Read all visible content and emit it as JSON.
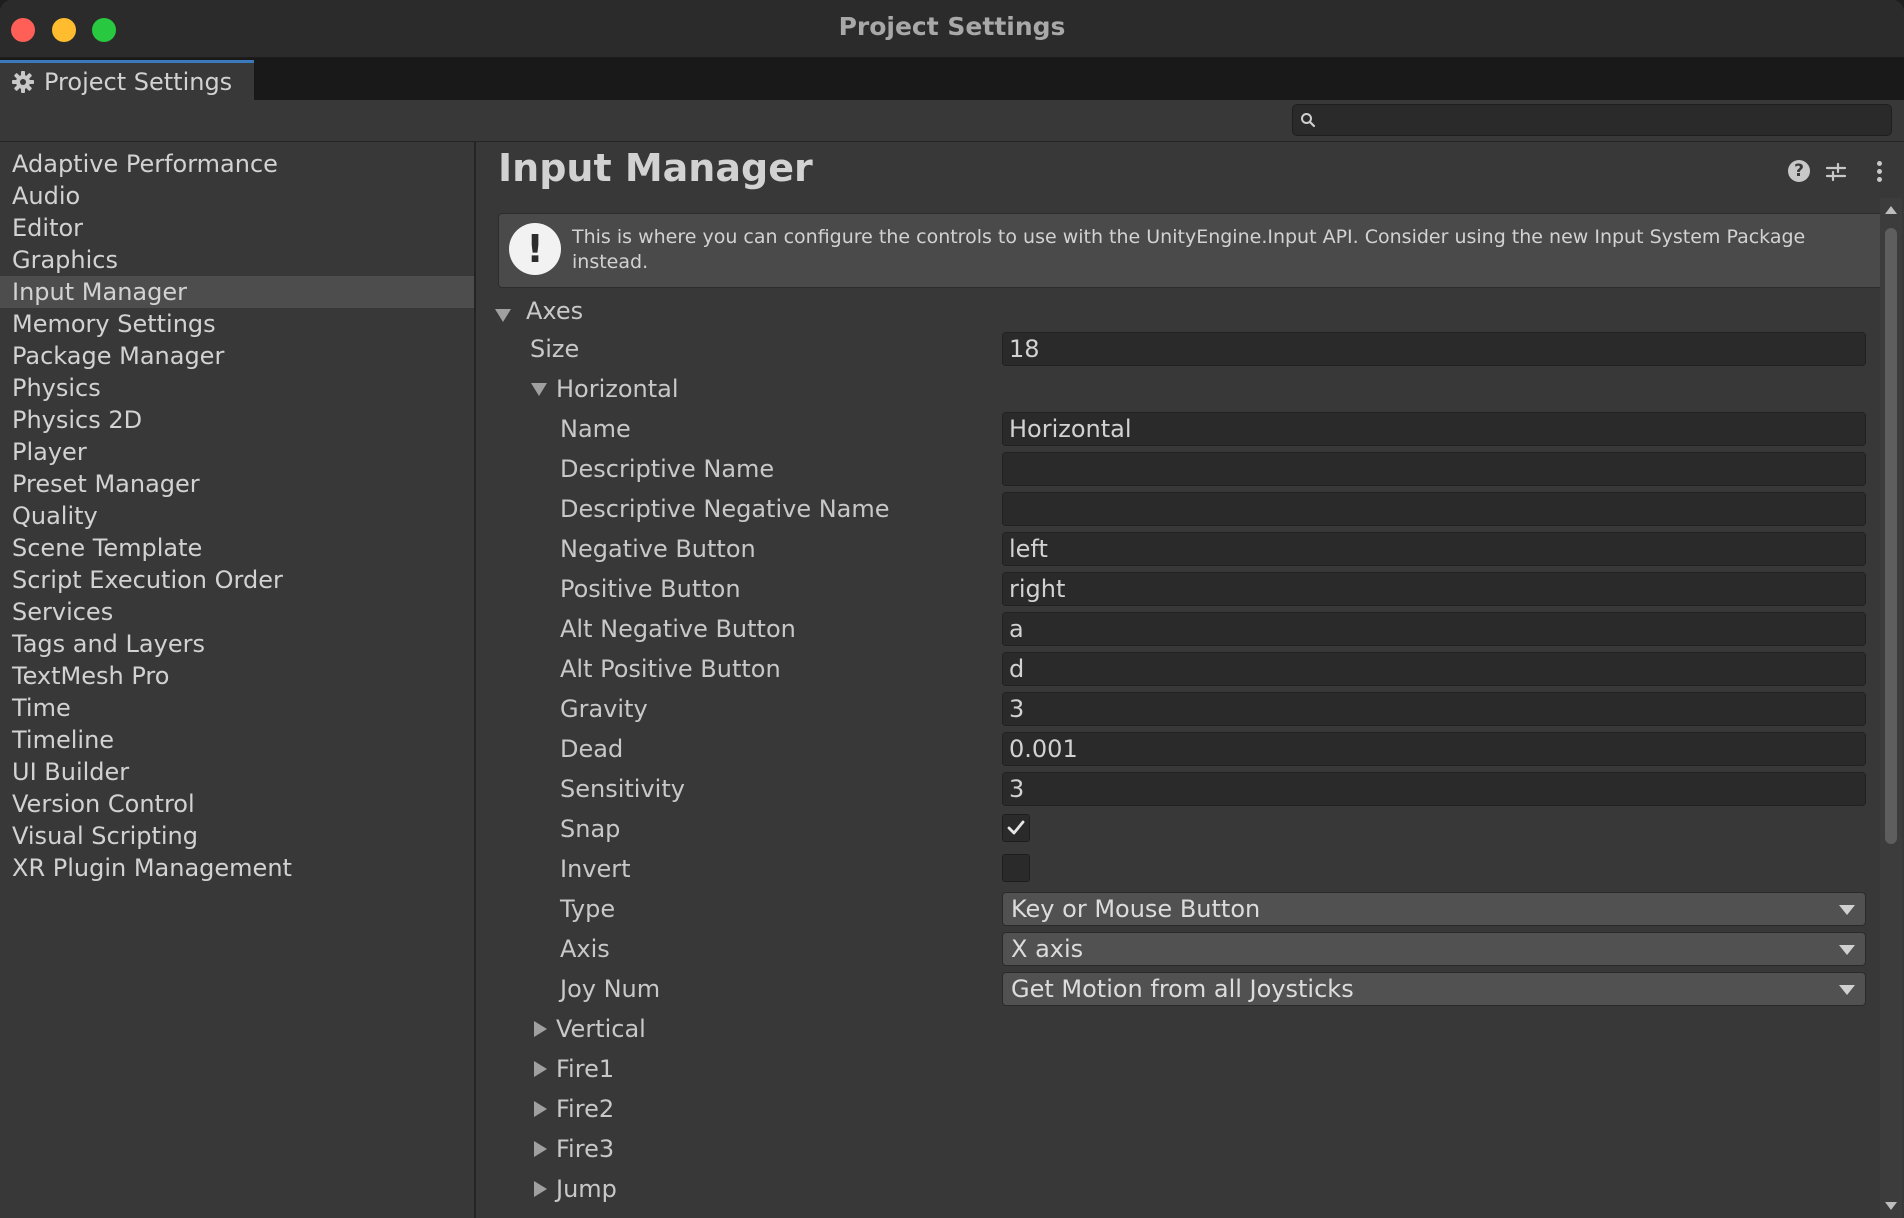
{
  "window": {
    "title": "Project Settings"
  },
  "tab": {
    "label": "Project Settings",
    "icon": "gear-icon"
  },
  "search": {
    "value": "",
    "placeholder": ""
  },
  "sidebar": {
    "items": [
      {
        "label": "Adaptive Performance"
      },
      {
        "label": "Audio"
      },
      {
        "label": "Editor"
      },
      {
        "label": "Graphics"
      },
      {
        "label": "Input Manager",
        "selected": true
      },
      {
        "label": "Memory Settings"
      },
      {
        "label": "Package Manager"
      },
      {
        "label": "Physics"
      },
      {
        "label": "Physics 2D"
      },
      {
        "label": "Player"
      },
      {
        "label": "Preset Manager"
      },
      {
        "label": "Quality"
      },
      {
        "label": "Scene Template"
      },
      {
        "label": "Script Execution Order"
      },
      {
        "label": "Services"
      },
      {
        "label": "Tags and Layers"
      },
      {
        "label": "TextMesh Pro"
      },
      {
        "label": "Time"
      },
      {
        "label": "Timeline"
      },
      {
        "label": "UI Builder"
      },
      {
        "label": "Version Control"
      },
      {
        "label": "Visual Scripting"
      },
      {
        "label": "XR Plugin Management"
      }
    ]
  },
  "page": {
    "title": "Input Manager",
    "help_text": "This is where you can configure the controls to use with the UnityEngine.Input API. Consider using the new Input System Package instead.",
    "axes": {
      "label": "Axes",
      "size_label": "Size",
      "size_value": "18",
      "horizontal": {
        "label": "Horizontal",
        "fields": {
          "name_label": "Name",
          "name_value": "Horizontal",
          "desc_name_label": "Descriptive Name",
          "desc_name_value": "",
          "desc_neg_name_label": "Descriptive Negative Name",
          "desc_neg_name_value": "",
          "neg_button_label": "Negative Button",
          "neg_button_value": "left",
          "pos_button_label": "Positive Button",
          "pos_button_value": "right",
          "alt_neg_button_label": "Alt Negative Button",
          "alt_neg_button_value": "a",
          "alt_pos_button_label": "Alt Positive Button",
          "alt_pos_button_value": "d",
          "gravity_label": "Gravity",
          "gravity_value": "3",
          "dead_label": "Dead",
          "dead_value": "0.001",
          "sensitivity_label": "Sensitivity",
          "sensitivity_value": "3",
          "snap_label": "Snap",
          "snap_checked": true,
          "invert_label": "Invert",
          "invert_checked": false,
          "type_label": "Type",
          "type_value": "Key or Mouse Button",
          "axis_label": "Axis",
          "axis_value": "X axis",
          "joy_num_label": "Joy Num",
          "joy_num_value": "Get Motion from all Joysticks"
        }
      },
      "collapsed": [
        {
          "label": "Vertical"
        },
        {
          "label": "Fire1"
        },
        {
          "label": "Fire2"
        },
        {
          "label": "Fire3"
        },
        {
          "label": "Jump"
        }
      ]
    }
  }
}
